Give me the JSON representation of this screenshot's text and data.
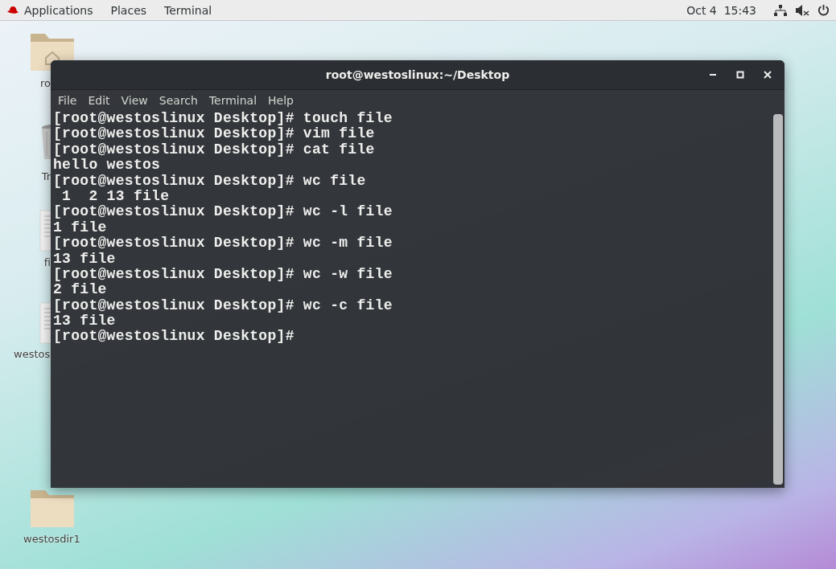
{
  "top_bar": {
    "menus": [
      "Applications",
      "Places",
      "Terminal"
    ],
    "clock": "Oct 4  15:43"
  },
  "desktop_icons": [
    {
      "kind": "home",
      "label": "ro"
    },
    {
      "kind": "trash",
      "label": "Tr"
    },
    {
      "kind": "document",
      "label": "fi"
    },
    {
      "kind": "document",
      "label": "westos"
    },
    {
      "kind": "folder",
      "label": "westosdir1"
    }
  ],
  "terminal": {
    "title": "root@westoslinux:~/Desktop",
    "menu": [
      "File",
      "Edit",
      "View",
      "Search",
      "Terminal",
      "Help"
    ],
    "lines": [
      "[root@westoslinux Desktop]# touch file",
      "[root@westoslinux Desktop]# vim file",
      "[root@westoslinux Desktop]# cat file",
      "hello westos",
      "[root@westoslinux Desktop]# wc file",
      " 1  2 13 file",
      "[root@westoslinux Desktop]# wc -l file",
      "1 file",
      "[root@westoslinux Desktop]# wc -m file",
      "13 file",
      "[root@westoslinux Desktop]# wc -w file",
      "2 file",
      "[root@westoslinux Desktop]# wc -c file",
      "13 file",
      "[root@westoslinux Desktop]# "
    ]
  }
}
